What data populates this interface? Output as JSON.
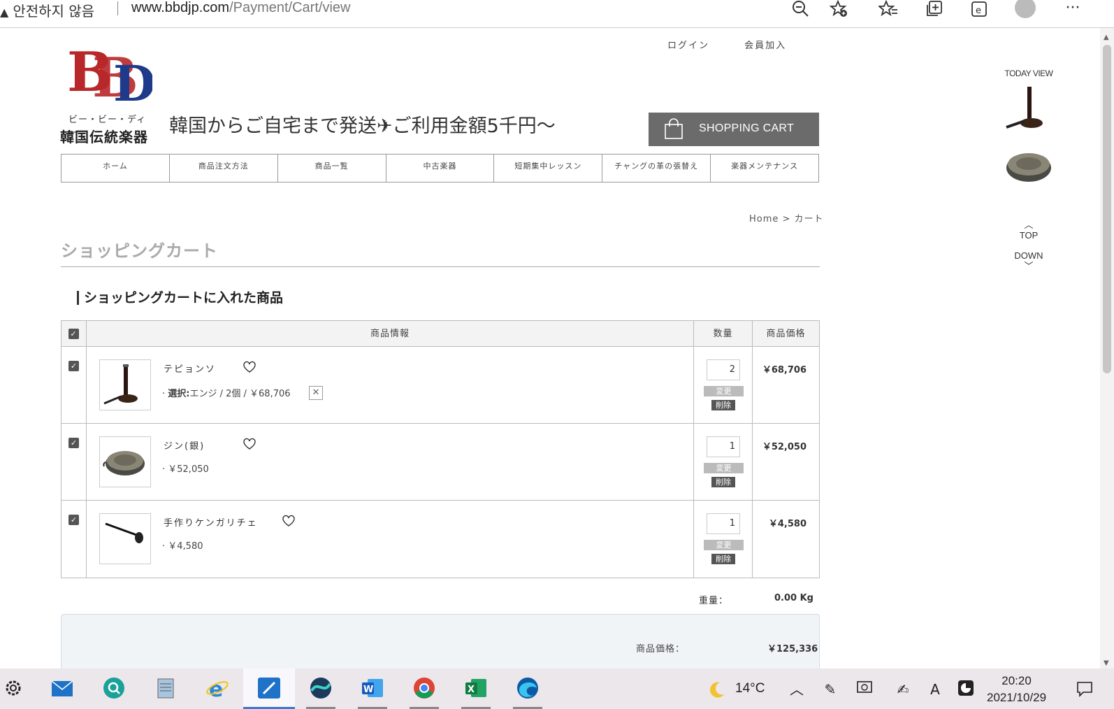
{
  "browser": {
    "security_warning": "안전하지 않음",
    "url_host": "www.bbdjp.com",
    "url_path": "/Payment/Cart/view"
  },
  "header": {
    "logo_sub_kana": "ビー・ビー・ディー",
    "logo_sub_name": "韓国伝統楽器",
    "login_label": "ログイン",
    "signup_label": "会員加入",
    "tagline": "韓国からご自宅まで発送✈ご利用金額5千円〜",
    "cart_button_label": "SHOPPING CART"
  },
  "nav": {
    "items": [
      "ホーム",
      "商品注文方法",
      "商品一覧",
      "中古楽器",
      "短期集中レッスン",
      "チャングの革の張替え",
      "楽器メンテナンス"
    ]
  },
  "breadcrumb": "Home > カート",
  "page_title": "ショッピングカート",
  "section_title": "ショッピングカートに入れた商品",
  "table": {
    "headers": {
      "info": "商品情報",
      "qty": "数量",
      "price": "商品価格"
    },
    "change_label": "変更",
    "delete_label": "削除",
    "remove_option_label": "✕",
    "rows": [
      {
        "name": "テピョンソ",
        "option_prefix": "選択:",
        "option": "エンジ / 2個 / ￥68,706",
        "qty": "2",
        "price": "￥68,706"
      },
      {
        "name": "ジン(銀)",
        "option_prefix": "",
        "option": "￥52,050",
        "qty": "1",
        "price": "￥52,050"
      },
      {
        "name": "手作りケンガリチェ",
        "option_prefix": "",
        "option": "￥4,580",
        "qty": "1",
        "price": "￥4,580"
      }
    ]
  },
  "weight": {
    "label": "重量：",
    "value": "0.00 Kg"
  },
  "summary": {
    "label": "商品価格：",
    "value": "￥125,336"
  },
  "side_panel": {
    "title": "TODAY VIEW",
    "top_label": "TOP",
    "down_label": "DOWN"
  },
  "taskbar": {
    "weather": "14°C",
    "time": "20:20",
    "date": "2021/10/29"
  },
  "colors": {
    "cart_button_bg": "#6b6b6b",
    "summary_bg": "#f1f4f7",
    "logo_red": "#b8282a",
    "logo_blue": "#1f3a8a"
  }
}
